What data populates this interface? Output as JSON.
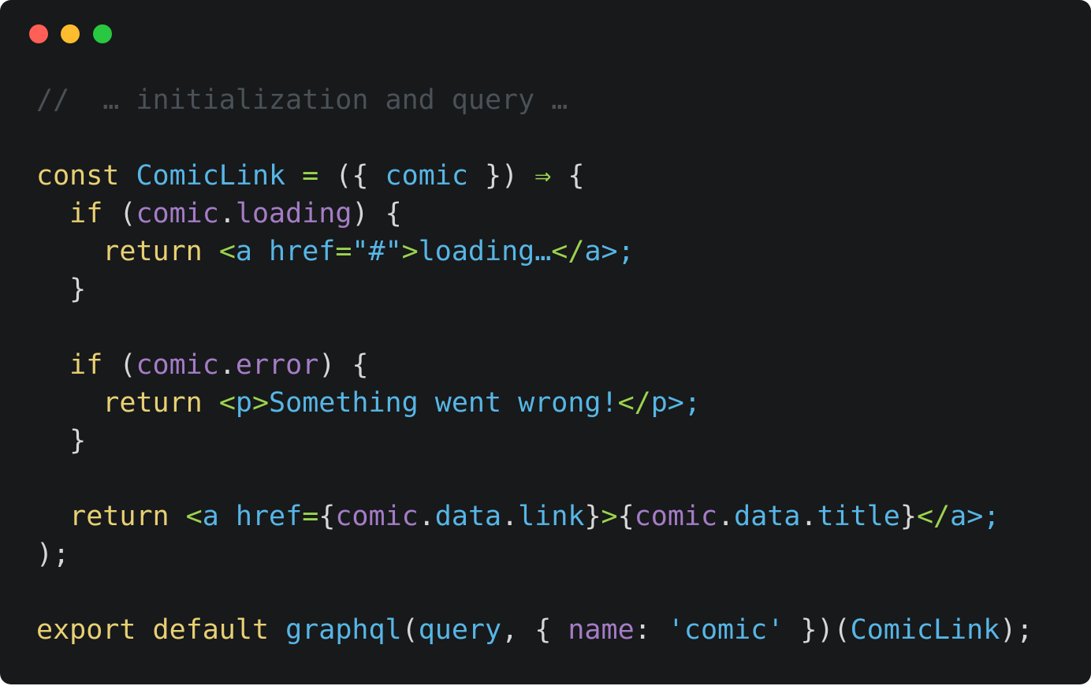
{
  "window": {
    "traffic_lights": [
      {
        "name": "close",
        "color": "#ff5f57"
      },
      {
        "name": "minimize",
        "color": "#febc2e"
      },
      {
        "name": "zoom",
        "color": "#28c840"
      }
    ]
  },
  "colors": {
    "background": "#17191b",
    "comment": "#4a5157",
    "plain": "#d6d6d6",
    "keyword": "#e8d073",
    "identifier": "#57b6e6",
    "property": "#a57cc6",
    "operator": "#9cd34f"
  },
  "code_lines": [
    [
      {
        "t": "//  … initialization and query …",
        "k": "comment"
      }
    ],
    [],
    [
      {
        "t": "const",
        "k": "keyword"
      },
      {
        "t": " ",
        "k": "plain"
      },
      {
        "t": "ComicLink",
        "k": "identifier"
      },
      {
        "t": " ",
        "k": "plain"
      },
      {
        "t": "=",
        "k": "operator"
      },
      {
        "t": " ({ ",
        "k": "plain"
      },
      {
        "t": "comic",
        "k": "identifier"
      },
      {
        "t": " }) ",
        "k": "plain"
      },
      {
        "t": "⇒",
        "k": "operator"
      },
      {
        "t": " {",
        "k": "plain"
      }
    ],
    [
      {
        "t": "  ",
        "k": "plain"
      },
      {
        "t": "if",
        "k": "keyword"
      },
      {
        "t": " (",
        "k": "plain"
      },
      {
        "t": "comic",
        "k": "property"
      },
      {
        "t": ".",
        "k": "plain"
      },
      {
        "t": "loading",
        "k": "property"
      },
      {
        "t": ") {",
        "k": "plain"
      }
    ],
    [
      {
        "t": "    ",
        "k": "plain"
      },
      {
        "t": "return",
        "k": "keyword"
      },
      {
        "t": " ",
        "k": "plain"
      },
      {
        "t": "<",
        "k": "operator"
      },
      {
        "t": "a",
        "k": "identifier"
      },
      {
        "t": " ",
        "k": "plain"
      },
      {
        "t": "href",
        "k": "identifier"
      },
      {
        "t": "=",
        "k": "operator"
      },
      {
        "t": "\"#\"",
        "k": "identifier"
      },
      {
        "t": ">",
        "k": "operator"
      },
      {
        "t": "loading…",
        "k": "identifier"
      },
      {
        "t": "</",
        "k": "operator"
      },
      {
        "t": "a",
        "k": "identifier"
      },
      {
        "t": ">;",
        "k": "identifier"
      }
    ],
    [
      {
        "t": "  }",
        "k": "plain"
      }
    ],
    [],
    [
      {
        "t": "  ",
        "k": "plain"
      },
      {
        "t": "if",
        "k": "keyword"
      },
      {
        "t": " (",
        "k": "plain"
      },
      {
        "t": "comic",
        "k": "property"
      },
      {
        "t": ".",
        "k": "plain"
      },
      {
        "t": "error",
        "k": "property"
      },
      {
        "t": ") {",
        "k": "plain"
      }
    ],
    [
      {
        "t": "    ",
        "k": "plain"
      },
      {
        "t": "return",
        "k": "keyword"
      },
      {
        "t": " ",
        "k": "plain"
      },
      {
        "t": "<",
        "k": "operator"
      },
      {
        "t": "p",
        "k": "identifier"
      },
      {
        "t": ">",
        "k": "operator"
      },
      {
        "t": "Something went wrong!",
        "k": "identifier"
      },
      {
        "t": "</",
        "k": "operator"
      },
      {
        "t": "p",
        "k": "identifier"
      },
      {
        "t": ">;",
        "k": "identifier"
      }
    ],
    [
      {
        "t": "  }",
        "k": "plain"
      }
    ],
    [],
    [
      {
        "t": "  ",
        "k": "plain"
      },
      {
        "t": "return",
        "k": "keyword"
      },
      {
        "t": " ",
        "k": "plain"
      },
      {
        "t": "<",
        "k": "operator"
      },
      {
        "t": "a",
        "k": "identifier"
      },
      {
        "t": " ",
        "k": "plain"
      },
      {
        "t": "href",
        "k": "identifier"
      },
      {
        "t": "=",
        "k": "operator"
      },
      {
        "t": "{",
        "k": "plain"
      },
      {
        "t": "comic",
        "k": "property"
      },
      {
        "t": ".",
        "k": "plain"
      },
      {
        "t": "data",
        "k": "identifier"
      },
      {
        "t": ".",
        "k": "plain"
      },
      {
        "t": "link",
        "k": "identifier"
      },
      {
        "t": "}",
        "k": "plain"
      },
      {
        "t": ">",
        "k": "operator"
      },
      {
        "t": "{",
        "k": "plain"
      },
      {
        "t": "comic",
        "k": "property"
      },
      {
        "t": ".",
        "k": "plain"
      },
      {
        "t": "data",
        "k": "identifier"
      },
      {
        "t": ".",
        "k": "plain"
      },
      {
        "t": "title",
        "k": "identifier"
      },
      {
        "t": "}",
        "k": "plain"
      },
      {
        "t": "</",
        "k": "operator"
      },
      {
        "t": "a",
        "k": "identifier"
      },
      {
        "t": ">;",
        "k": "identifier"
      }
    ],
    [
      {
        "t": ");",
        "k": "plain"
      }
    ],
    [],
    [
      {
        "t": "export",
        "k": "keyword"
      },
      {
        "t": " ",
        "k": "plain"
      },
      {
        "t": "default",
        "k": "keyword"
      },
      {
        "t": " ",
        "k": "plain"
      },
      {
        "t": "graphql",
        "k": "identifier"
      },
      {
        "t": "(",
        "k": "plain"
      },
      {
        "t": "query",
        "k": "identifier"
      },
      {
        "t": ", { ",
        "k": "plain"
      },
      {
        "t": "name",
        "k": "property"
      },
      {
        "t": ": ",
        "k": "plain"
      },
      {
        "t": "'comic'",
        "k": "identifier"
      },
      {
        "t": " })(",
        "k": "plain"
      },
      {
        "t": "ComicLink",
        "k": "identifier"
      },
      {
        "t": ");",
        "k": "plain"
      }
    ]
  ]
}
